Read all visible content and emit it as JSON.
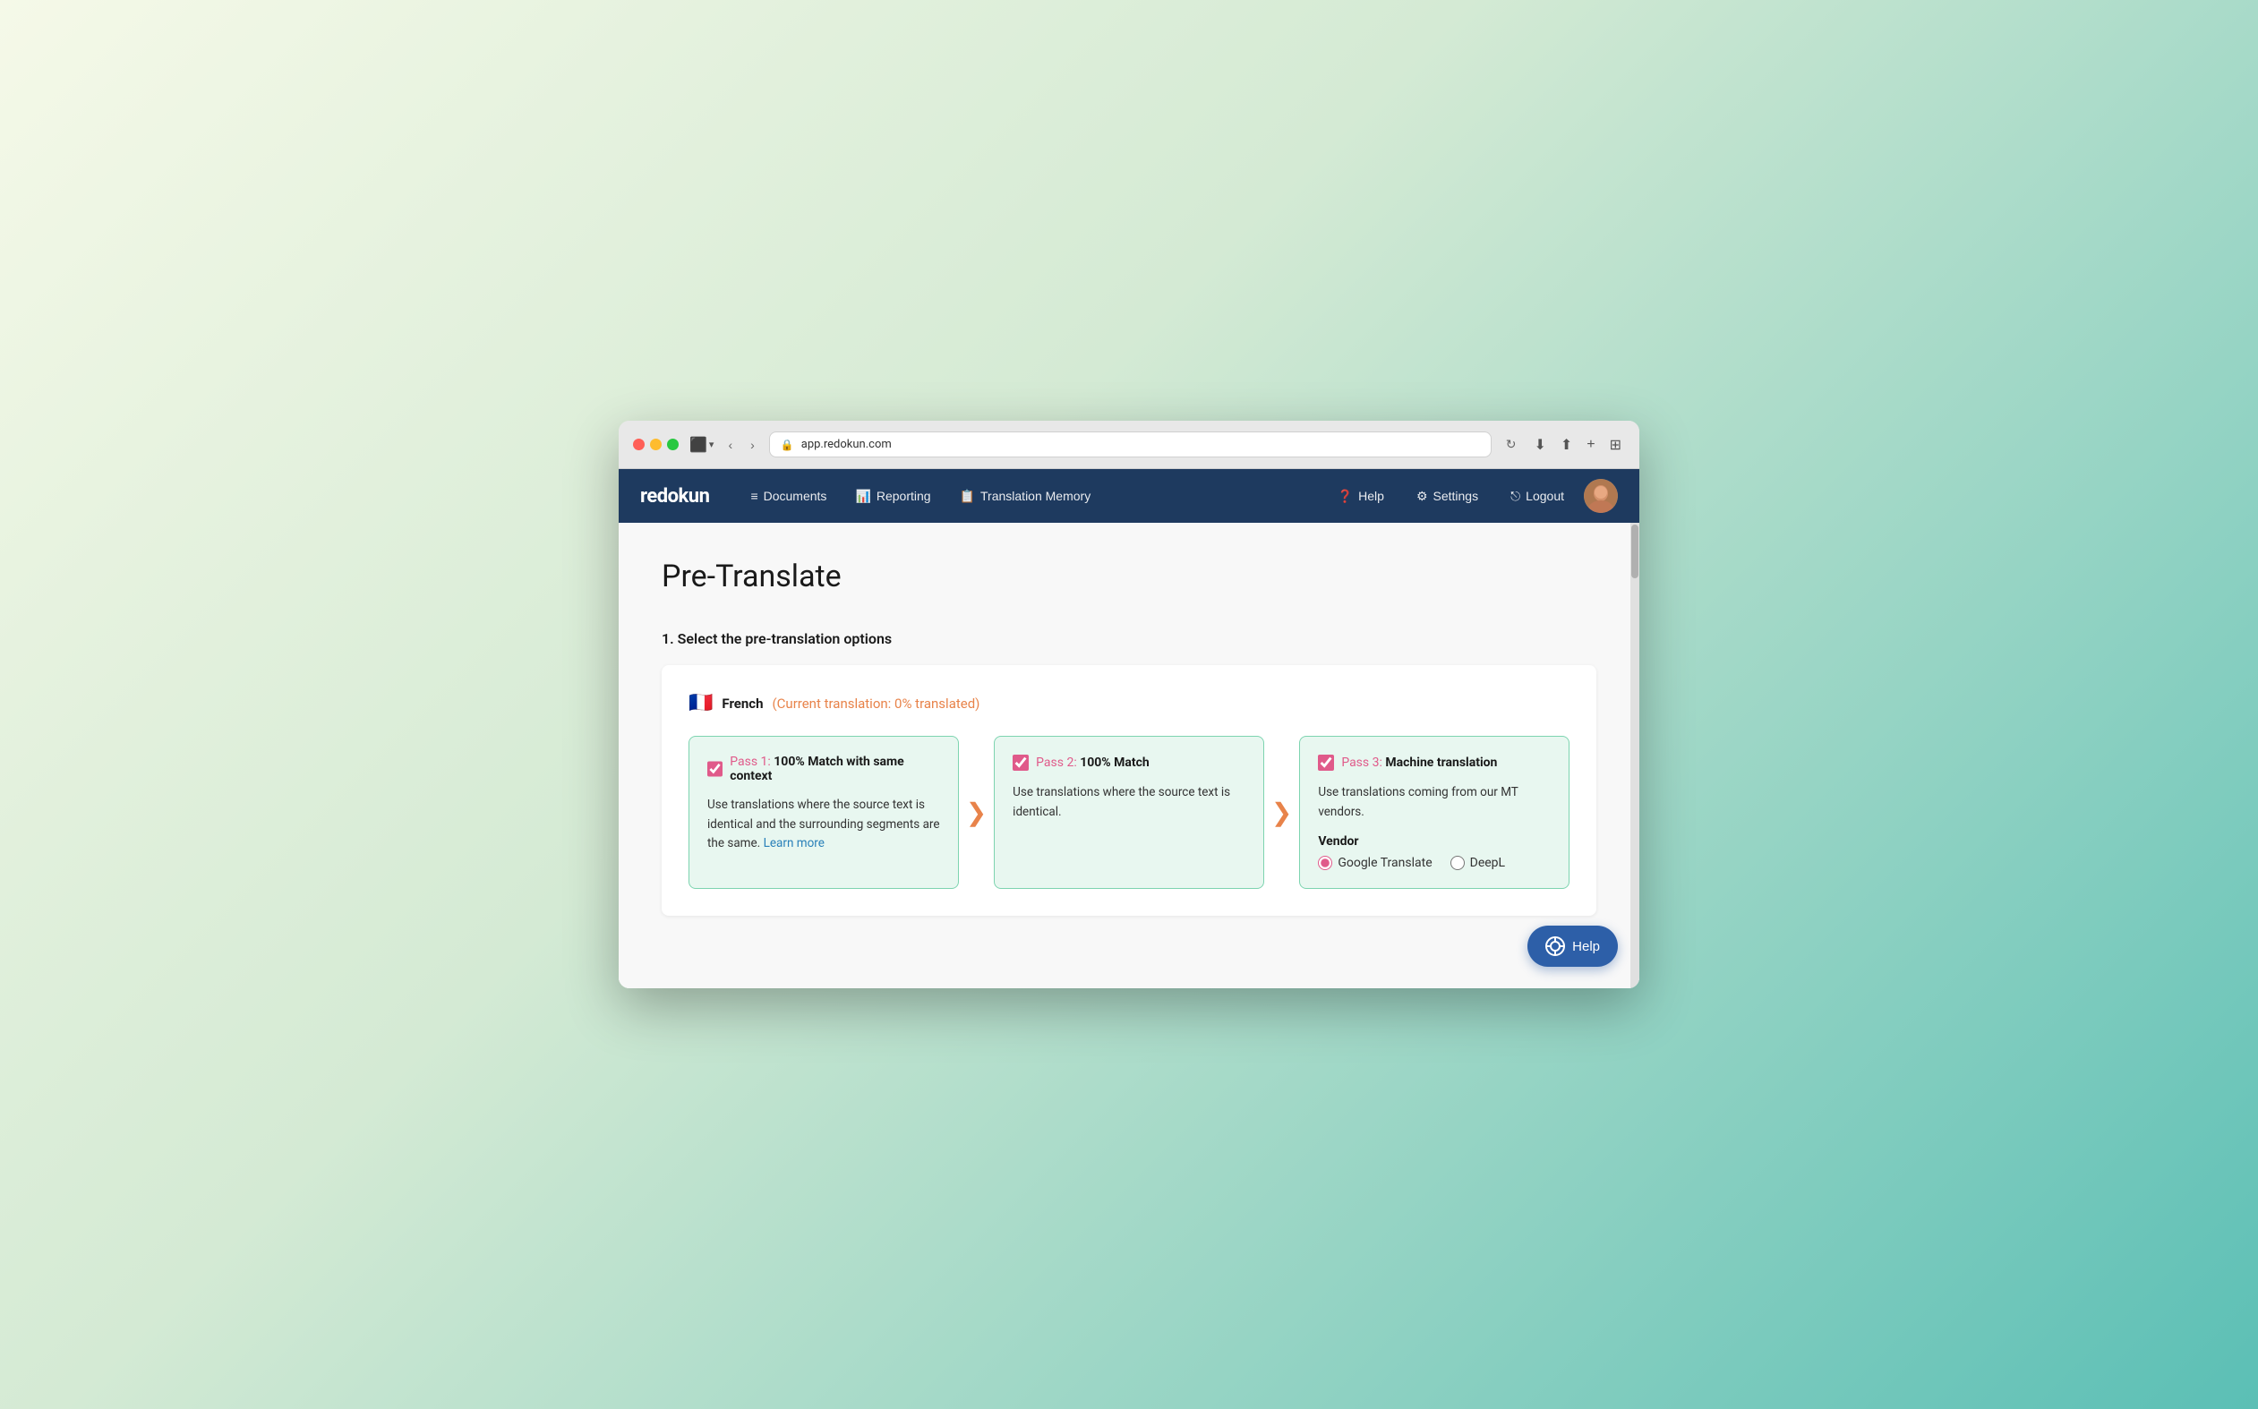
{
  "browser": {
    "url": "app.redokun.com",
    "dots": [
      "red",
      "yellow",
      "green"
    ]
  },
  "nav": {
    "logo": "redokun",
    "items": [
      {
        "id": "documents",
        "icon": "≡",
        "label": "Documents"
      },
      {
        "id": "reporting",
        "icon": "📊",
        "label": "Reporting"
      },
      {
        "id": "translation-memory",
        "icon": "📋",
        "label": "Translation Memory"
      }
    ],
    "right_items": [
      {
        "id": "help",
        "icon": "❓",
        "label": "Help"
      },
      {
        "id": "settings",
        "icon": "⚙",
        "label": "Settings"
      },
      {
        "id": "logout",
        "icon": "→",
        "label": "Logout"
      }
    ]
  },
  "page": {
    "title": "Pre-Translate",
    "section_heading": "1. Select the pre-translation options",
    "language": {
      "flag": "🇫🇷",
      "name": "French",
      "status": "(Current translation: 0% translated)"
    },
    "passes": [
      {
        "id": "pass1",
        "label": "Pass 1:",
        "name": "100% Match with same context",
        "checked": true,
        "description": "Use translations where the source text is identical and the surrounding segments are the same.",
        "link_text": "Learn more",
        "link_url": "#"
      },
      {
        "id": "pass2",
        "label": "Pass 2:",
        "name": "100% Match",
        "checked": true,
        "description": "Use translations where the source text is identical.",
        "link_text": null
      },
      {
        "id": "pass3",
        "label": "Pass 3:",
        "name": "Machine translation",
        "checked": true,
        "description": "Use translations coming from our MT vendors.",
        "vendor_label": "Vendor",
        "vendors": [
          {
            "id": "google",
            "label": "Google Translate",
            "selected": true
          },
          {
            "id": "deepl",
            "label": "DeepL",
            "selected": false
          }
        ]
      }
    ],
    "arrow": "❯",
    "help_button": "Help"
  }
}
